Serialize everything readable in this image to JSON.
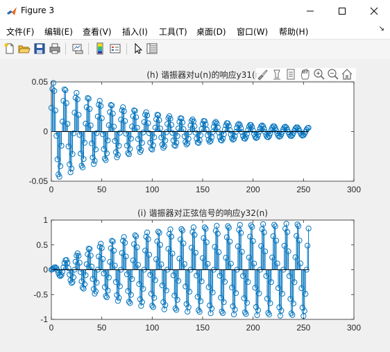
{
  "window": {
    "title": "Figure 3",
    "controls": {
      "minimize": "minimize",
      "maximize": "maximize",
      "close": "close"
    }
  },
  "menu": [
    {
      "label": "文件(F)"
    },
    {
      "label": "编辑(E)"
    },
    {
      "label": "查看(V)"
    },
    {
      "label": "插入(I)"
    },
    {
      "label": "工具(T)"
    },
    {
      "label": "桌面(D)"
    },
    {
      "label": "窗口(W)"
    },
    {
      "label": "帮助(H)"
    }
  ],
  "toolbar_icons": [
    "new-figure-icon",
    "open-file-icon",
    "save-icon",
    "print-icon",
    "link-plot-icon",
    "colorbar-icon",
    "legend-icon",
    "pointer-icon",
    "property-inspector-icon"
  ],
  "axes_toolbar_icons": [
    "brush-icon",
    "data-tips-icon",
    "pan-restore-icon",
    "pan-icon",
    "zoom-in-icon",
    "zoom-out-icon",
    "home-icon"
  ],
  "chart_data": [
    {
      "type": "stem",
      "title": "(h) 谐振器对u(n)的响应y31(n)",
      "title_visible": "(h) 谐振器对u(n)的响应y31(r",
      "xlabel": "",
      "ylabel": "",
      "xlim": [
        0,
        300
      ],
      "ylim": [
        -0.05,
        0.05
      ],
      "xticks": [
        0,
        50,
        100,
        150,
        200,
        250,
        300
      ],
      "yticks": [
        -0.05,
        0,
        0.05
      ],
      "ytick_labels": [
        "-0.05",
        "0",
        "0.05"
      ],
      "n": [
        0,
        255
      ],
      "model": {
        "amplitude": 0.05,
        "decay": 0.01,
        "period": 11.5,
        "phase": 0.5
      },
      "color": "#0072bd",
      "grid": false
    },
    {
      "type": "stem",
      "title": "(i) 谐振器对正弦信号的响应y32(n)",
      "xlabel": "",
      "ylabel": "",
      "xlim": [
        0,
        300
      ],
      "ylim": [
        -1,
        1
      ],
      "xticks": [
        0,
        50,
        100,
        150,
        200,
        250,
        300
      ],
      "yticks": [
        -1,
        -0.5,
        0,
        0.5,
        1
      ],
      "ytick_labels": [
        "-1",
        "-0.5",
        "0",
        "0.5",
        "1"
      ],
      "n": [
        0,
        255
      ],
      "model": {
        "amplitude": 0.95,
        "growth_rate": 0.0165,
        "period": 11.5
      },
      "color": "#0072bd",
      "grid": false
    }
  ]
}
